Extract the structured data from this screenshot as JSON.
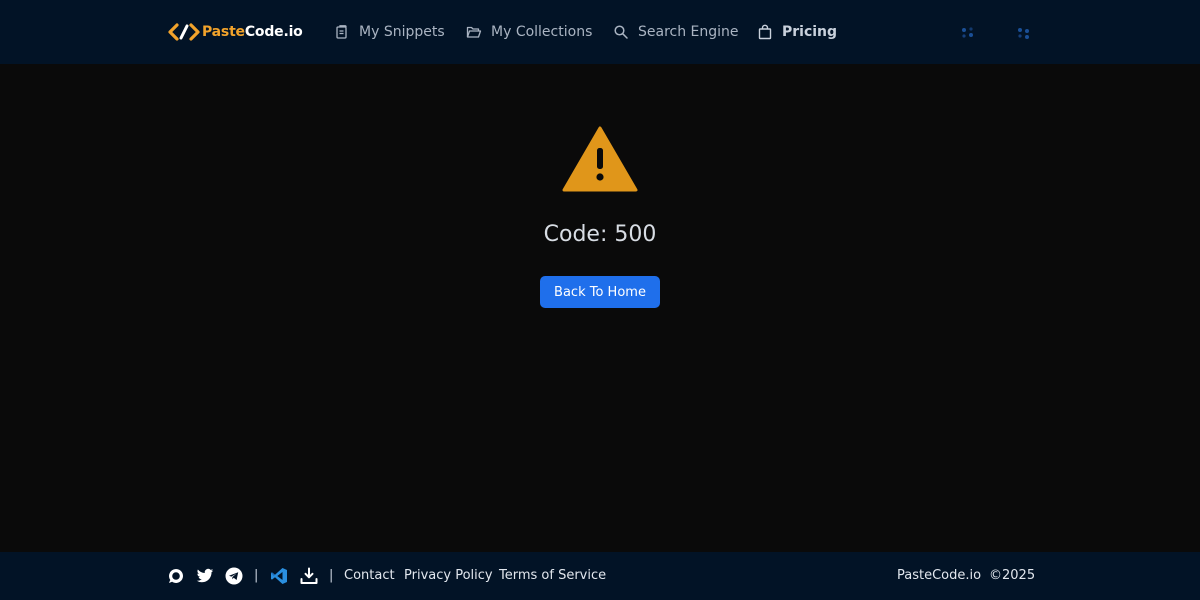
{
  "brand": {
    "name_part1": "Paste",
    "name_part2": "Code.io",
    "accent_color": "#f2a32b",
    "logo_icon": "code-brackets-icon"
  },
  "nav": {
    "items": [
      {
        "label": "My Snippets",
        "icon": "clipboard-icon"
      },
      {
        "label": "My Collections",
        "icon": "folder-open-icon"
      },
      {
        "label": "Search Engine",
        "icon": "search-icon"
      },
      {
        "label": "Pricing",
        "icon": "shopping-bag-icon"
      }
    ],
    "right_icons": [
      "loading-dots-icon",
      "loading-dots-icon"
    ]
  },
  "error": {
    "icon": "warning-triangle-icon",
    "icon_color": "#e0961a",
    "code_text": "Code: 500",
    "button_label": "Back To Home",
    "button_color": "#1f6feb"
  },
  "footer": {
    "social_icons": [
      "discord-icon",
      "twitter-icon",
      "telegram-icon"
    ],
    "separator": "|",
    "tool_icons": [
      "vscode-icon",
      "download-icon"
    ],
    "links": [
      "Contact",
      "Privacy Policy",
      "Terms of Service"
    ],
    "site_name": "PasteCode.io",
    "copyright": "©2025"
  },
  "colors": {
    "header_bg": "#021326",
    "page_bg": "#0a0a0a"
  }
}
